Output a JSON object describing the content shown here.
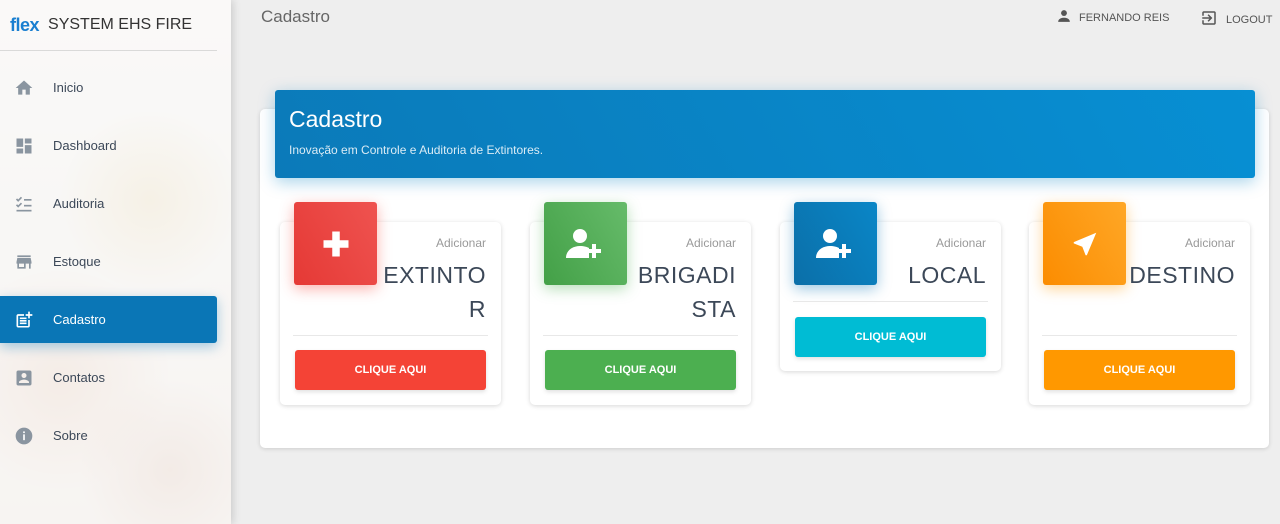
{
  "brand": {
    "logo": "flex",
    "name": "SYSTEM EHS FIRE"
  },
  "sidebar": {
    "items": [
      {
        "label": "Inicio",
        "icon": "home-icon"
      },
      {
        "label": "Dashboard",
        "icon": "dashboard-icon"
      },
      {
        "label": "Auditoria",
        "icon": "checklist-icon"
      },
      {
        "label": "Estoque",
        "icon": "store-icon"
      },
      {
        "label": "Cadastro",
        "icon": "post-add-icon",
        "active": true
      },
      {
        "label": "Contatos",
        "icon": "contact-icon"
      },
      {
        "label": "Sobre",
        "icon": "info-icon"
      }
    ]
  },
  "topbar": {
    "title": "Cadastro",
    "user": "FERNANDO REIS",
    "logout": "LOGOUT"
  },
  "header": {
    "title": "Cadastro",
    "subtitle": "Inovação em Controle e Auditoria de Extintores."
  },
  "cards": [
    {
      "category": "Adicionar",
      "value": "EXTINTOR",
      "button": "CLIQUE AQUI",
      "color": "#f44336",
      "icon": "plus-icon"
    },
    {
      "category": "Adicionar",
      "value": "BRIGADISTA",
      "button": "CLIQUE AQUI",
      "color": "#4caf50",
      "icon": "add-user-icon"
    },
    {
      "category": "Adicionar",
      "value": "LOCAL",
      "button": "CLIQUE AQUI",
      "color": "#00bcd4",
      "icon": "add-user-icon"
    },
    {
      "category": "Adicionar",
      "value": "DESTINO",
      "button": "CLIQUE AQUI",
      "color": "#ff9800",
      "icon": "navigation-icon"
    }
  ]
}
